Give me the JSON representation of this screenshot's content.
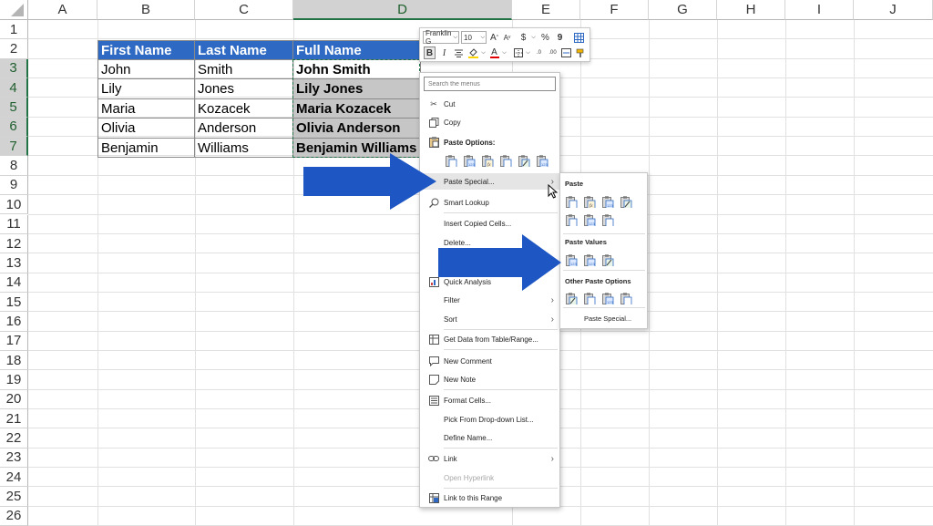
{
  "columns": [
    "A",
    "B",
    "C",
    "D",
    "E",
    "F",
    "G",
    "H",
    "I",
    "J"
  ],
  "selected_column": "D",
  "rows": [
    "1",
    "2",
    "3",
    "4",
    "5",
    "6",
    "7",
    "8",
    "9",
    "10",
    "11",
    "12",
    "13",
    "14",
    "15",
    "16",
    "17",
    "18",
    "19",
    "20",
    "21",
    "22",
    "23",
    "24",
    "25",
    "26"
  ],
  "table": {
    "headers": [
      "First Name",
      "Last Name",
      "Full Name"
    ],
    "rows": [
      [
        "John",
        "Smith",
        "John Smith"
      ],
      [
        "Lily",
        "Jones",
        "Lily  Jones"
      ],
      [
        "Maria",
        "Kozacek",
        "Maria  Kozacek"
      ],
      [
        "Olivia",
        "Anderson",
        "Olivia  Anderson"
      ],
      [
        "Benjamin",
        "Williams",
        "Benjamin Williams"
      ]
    ]
  },
  "mini_toolbar": {
    "font_name": "Franklin G",
    "font_size": "10",
    "grow_font": "A",
    "shrink_font": "A",
    "currency": "$",
    "percent": "%",
    "comma": "9",
    "bold": "B",
    "italic": "I",
    "font_color": "A"
  },
  "context_menu": {
    "search_placeholder": "Search the menus",
    "cut": "Cut",
    "copy": "Copy",
    "paste_options": "Paste Options:",
    "paste_special": "Paste Special...",
    "smart_lookup": "Smart Lookup",
    "insert_copied": "Insert Copied Cells...",
    "delete": "Delete...",
    "quick_analysis": "Quick Analysis",
    "filter": "Filter",
    "sort": "Sort",
    "get_data": "Get Data from Table/Range...",
    "new_comment": "New Comment",
    "new_note": "New Note",
    "format_cells": "Format Cells...",
    "pick_dropdown": "Pick From Drop-down List...",
    "define_name": "Define Name...",
    "link": "Link",
    "open_hyperlink": "Open Hyperlink",
    "link_range": "Link to this Range"
  },
  "submenu": {
    "paste": "Paste",
    "paste_values": "Paste Values",
    "other_paste": "Other Paste Options",
    "paste_special": "Paste Special..."
  },
  "colors": {
    "header_fill": "#2e6ac3",
    "arrow": "#1e57c4",
    "excel_green": "#217346"
  }
}
